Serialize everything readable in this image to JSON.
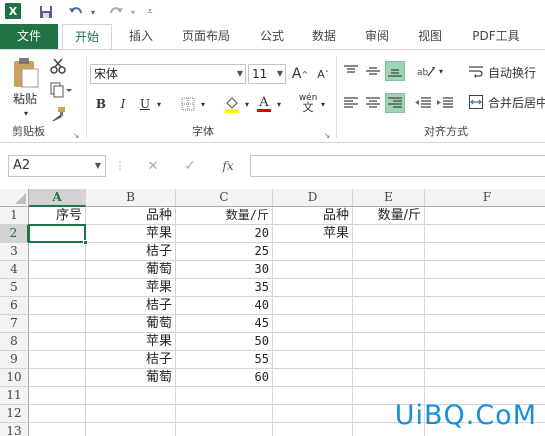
{
  "qat": {
    "app_icon": "X",
    "icons": [
      "save-icon",
      "undo-icon",
      "redo-icon",
      "customize-qat-icon"
    ]
  },
  "tabs": [
    "文件",
    "开始",
    "插入",
    "页面布局",
    "公式",
    "数据",
    "审阅",
    "视图",
    "PDF工具"
  ],
  "active_tab": "开始",
  "ribbon": {
    "clipboard": {
      "paste_label": "粘贴",
      "group_label": "剪贴板"
    },
    "font": {
      "font_name": "宋体",
      "font_size": "11",
      "bold": "B",
      "italic": "I",
      "underline": "U",
      "phonetic": "wén",
      "font_color_glyph": "A",
      "group_label": "字体",
      "grow_glyph": "A",
      "shrink_glyph": "A"
    },
    "alignment": {
      "wrap_text": "自动换行",
      "merge_center": "合并后居中",
      "group_label": "对齐方式"
    },
    "accent_color": "#217346"
  },
  "formula_bar": {
    "name_box": "A2",
    "cancel_glyph": "✕",
    "confirm_glyph": "✓",
    "fx_glyph": "fx",
    "formula": ""
  },
  "sheet": {
    "columns": [
      "A",
      "B",
      "C",
      "D",
      "E",
      "F"
    ],
    "rows": [
      "1",
      "2",
      "3",
      "4",
      "5",
      "6",
      "7",
      "8",
      "9",
      "10",
      "11",
      "12",
      "13"
    ],
    "active_cell": "A2",
    "cells": {
      "A1": "序号",
      "B1": "品种",
      "C1": "数量/斤",
      "D1": "品种",
      "E1": "数量/斤",
      "B2": "苹果",
      "C2": "20",
      "D2": "苹果",
      "B3": "桔子",
      "C3": "25",
      "B4": "葡萄",
      "C4": "30",
      "B5": "苹果",
      "C5": "35",
      "B6": "桔子",
      "C6": "40",
      "B7": "葡萄",
      "C7": "45",
      "B8": "苹果",
      "C8": "50",
      "B9": "桔子",
      "C9": "55",
      "B10": "葡萄",
      "C10": "60"
    }
  },
  "watermark": "UiBQ.CoM"
}
